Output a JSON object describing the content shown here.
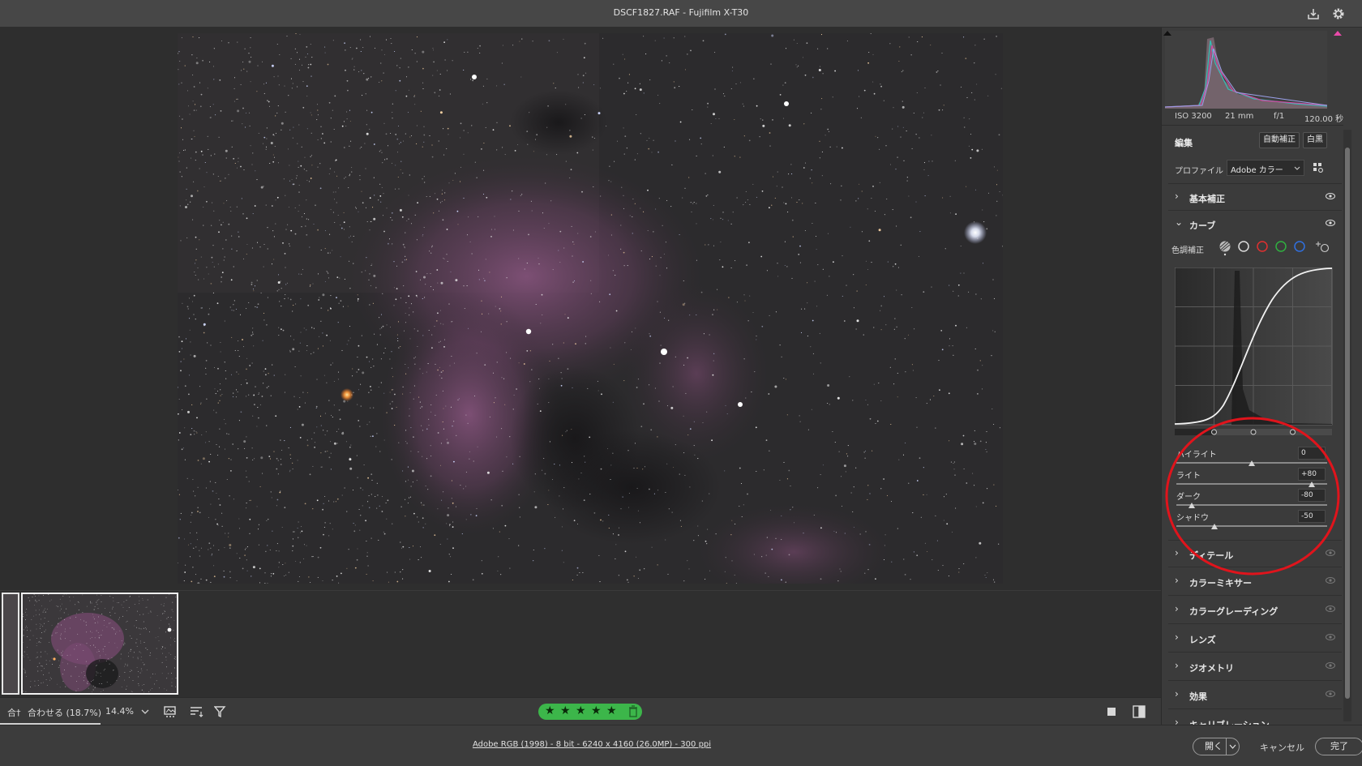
{
  "window": {
    "title": "DSCF1827.RAF  -  Fujifilm X-T30"
  },
  "toolbar_icons": {
    "export": "export-icon",
    "settings": "gear-icon"
  },
  "bottom_bar": {
    "left_cut_label": "合†",
    "zoom_fit_label": "合わせる (18.7%)",
    "zoom_value": "14.4%",
    "rating": 5,
    "accent_green": "#3cb64a"
  },
  "status": {
    "info": "Adobe RGB (1998) - 8 bit - 6240 x 4160 (26.0MP) - 300 ppi",
    "open_label": "開く",
    "cancel_label": "キャンセル",
    "done_label": "完了"
  },
  "exif": {
    "iso": "ISO 3200",
    "focal": "21 mm",
    "aperture": "f/1",
    "shutter": "120.00 秒"
  },
  "edit": {
    "heading": "編集",
    "auto_label": "自動補正",
    "bw_label": "白黒",
    "profile_label": "プロファイル",
    "profile_value": "Adobe カラー"
  },
  "sections": {
    "basic": "基本補正",
    "curve": "カーブ",
    "detail": "ディテール",
    "mixer": "カラーミキサー",
    "grading": "カラーグレーディング",
    "lens": "レンズ",
    "geometry": "ジオメトリ",
    "effects": "効果",
    "calibration": "キャリブレーション"
  },
  "curve": {
    "tone_label": "色調補正",
    "channels": [
      "parametric",
      "point",
      "red",
      "green",
      "blue"
    ],
    "sliders": [
      {
        "name": "ハイライト",
        "value": "0",
        "level": 0.5
      },
      {
        "name": "ライト",
        "value": "+80",
        "level": 0.9
      },
      {
        "name": "ダーク",
        "value": "-80",
        "level": 0.1
      },
      {
        "name": "シャドウ",
        "value": "-50",
        "level": 0.25
      }
    ],
    "highlight_ring_color": "#e0141c"
  }
}
